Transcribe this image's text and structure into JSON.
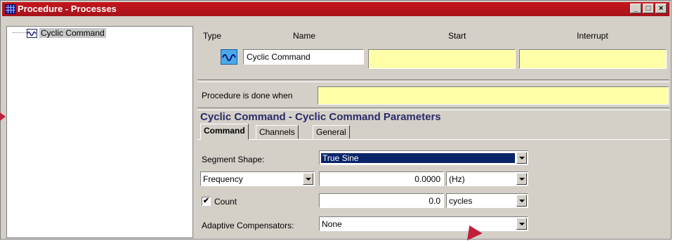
{
  "window": {
    "title": "Procedure - Processes",
    "minimize_label": "_",
    "maximize_label": "□",
    "close_label": "×"
  },
  "tree": {
    "items": [
      {
        "label": "Cyclic Command",
        "icon": "sine-wave-icon"
      }
    ]
  },
  "process_header": {
    "type_label": "Type",
    "name_label": "Name",
    "start_label": "Start",
    "interrupt_label": "Interrupt"
  },
  "process_row": {
    "type_icon": "sine-wave-icon",
    "name_value": "Cyclic Command",
    "start_value": "",
    "interrupt_value": ""
  },
  "done_when": {
    "label": "Procedure is done when",
    "value": ""
  },
  "params": {
    "title": "Cyclic Command - Cyclic Command Parameters",
    "tabs": [
      {
        "label": "Command",
        "active": true
      },
      {
        "label": "Channels",
        "active": false
      },
      {
        "label": "General",
        "active": false
      }
    ],
    "segment_shape_label": "Segment Shape:",
    "segment_shape_value": "True Sine",
    "frequency_select": "Frequency",
    "frequency_value": "0.0000",
    "frequency_unit": "(Hz)",
    "count_checked": true,
    "count_label": "Count",
    "count_check_mark": "✔",
    "count_value": "0.0",
    "count_unit": "cycles",
    "adaptive_label": "Adaptive Compensators:",
    "adaptive_value": "None"
  },
  "colors": {
    "titlebar": "#c4161c",
    "highlight_yellow": "#ffffa8",
    "selection": "#0a246a",
    "params_title": "#2a2a6a"
  }
}
